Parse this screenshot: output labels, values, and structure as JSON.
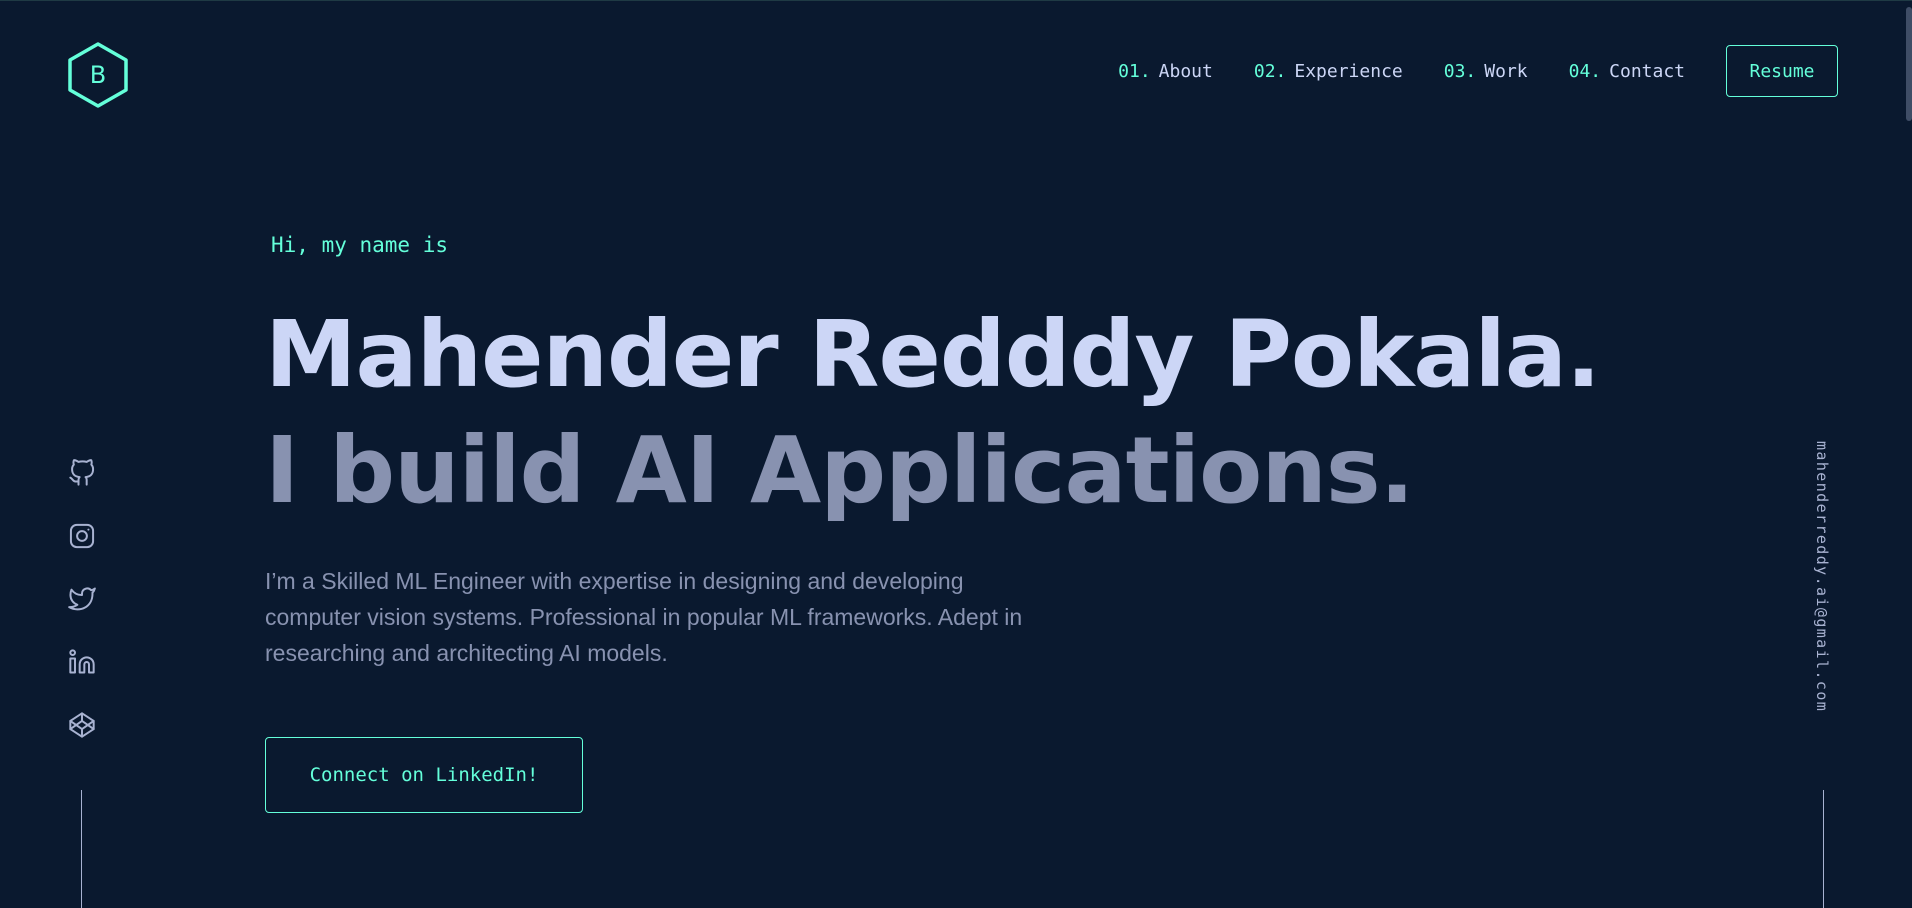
{
  "logo": {
    "letter": "B",
    "icon": "hexagon-logo-icon"
  },
  "nav": {
    "items": [
      {
        "num": "01.",
        "label": "About"
      },
      {
        "num": "02.",
        "label": "Experience"
      },
      {
        "num": "03.",
        "label": "Work"
      },
      {
        "num": "04.",
        "label": "Contact"
      }
    ],
    "resume_label": "Resume"
  },
  "hero": {
    "greeting": "Hi, my name is",
    "name": "Mahender Redddy Pokala.",
    "tagline": "I build AI Applications.",
    "description": "I’m a Skilled ML Engineer with expertise in designing and developing computer vision systems. Professional in popular ML frameworks. Adept in researching and architecting AI models.",
    "cta_label": "Connect on LinkedIn!"
  },
  "social": {
    "icons": [
      "github-icon",
      "instagram-icon",
      "twitter-icon",
      "linkedin-icon",
      "codepen-icon"
    ]
  },
  "email": "mahenderreddy.ai@gmail.com",
  "colors": {
    "background": "#0a192f",
    "accent": "#64ffda",
    "heading": "#ccd6f6",
    "muted": "#8892b0",
    "rail": "#a8b2d1"
  }
}
